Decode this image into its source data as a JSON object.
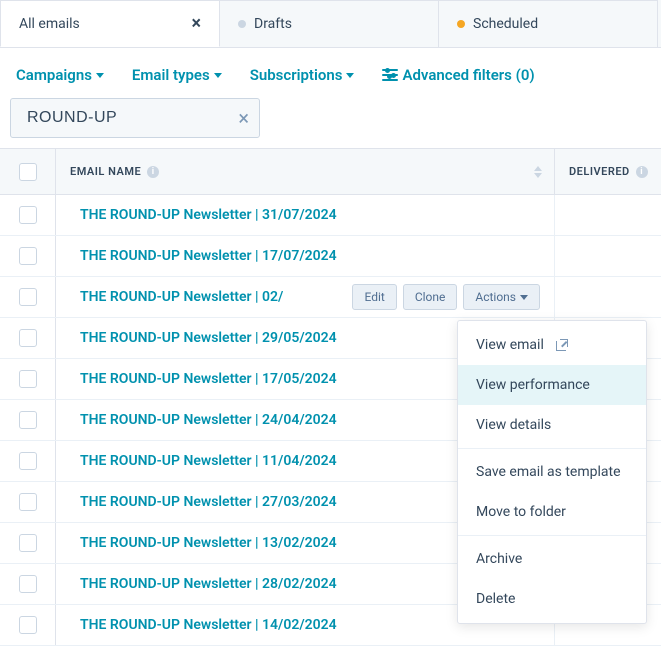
{
  "tabs": [
    {
      "label": "All emails",
      "active": true,
      "closable": true
    },
    {
      "label": "Drafts",
      "dot": "grey"
    },
    {
      "label": "Scheduled",
      "dot": "orange"
    }
  ],
  "filters": {
    "campaigns": "Campaigns",
    "email_types": "Email types",
    "subscriptions": "Subscriptions",
    "advanced": "Advanced filters (0)"
  },
  "search": {
    "value": "ROUND-UP"
  },
  "columns": {
    "name": "EMAIL NAME",
    "delivered": "DELIVERED"
  },
  "rows": [
    {
      "dot": "grey",
      "name": "THE ROUND-UP Newsletter | 31/07/2024"
    },
    {
      "dot": "green",
      "name": "THE ROUND-UP Newsletter | 17/07/2024"
    },
    {
      "dot": "green",
      "name": "THE ROUND-UP Newsletter | 02/",
      "hovered": true
    },
    {
      "dot": "green",
      "name": "THE ROUND-UP Newsletter | 29/05/2024"
    },
    {
      "dot": "green",
      "name": "THE ROUND-UP Newsletter | 17/05/2024"
    },
    {
      "dot": "green",
      "name": "THE ROUND-UP Newsletter | 24/04/2024"
    },
    {
      "dot": "green",
      "name": "THE ROUND-UP Newsletter | 11/04/2024"
    },
    {
      "dot": "green",
      "name": "THE ROUND-UP Newsletter | 27/03/2024"
    },
    {
      "dot": "green",
      "name": "THE ROUND-UP Newsletter | 13/02/2024"
    },
    {
      "dot": "green",
      "name": "THE ROUND-UP Newsletter | 28/02/2024"
    },
    {
      "dot": "green",
      "name": "THE ROUND-UP Newsletter | 14/02/2024"
    }
  ],
  "row_buttons": {
    "edit": "Edit",
    "clone": "Clone",
    "actions": "Actions"
  },
  "dropdown": [
    {
      "label": "View email",
      "ext": true
    },
    {
      "label": "View performance",
      "highlight": true
    },
    {
      "label": "View details"
    },
    {
      "sep": true
    },
    {
      "label": "Save email as template"
    },
    {
      "label": "Move to folder"
    },
    {
      "sep": true
    },
    {
      "label": "Archive"
    },
    {
      "label": "Delete"
    }
  ]
}
